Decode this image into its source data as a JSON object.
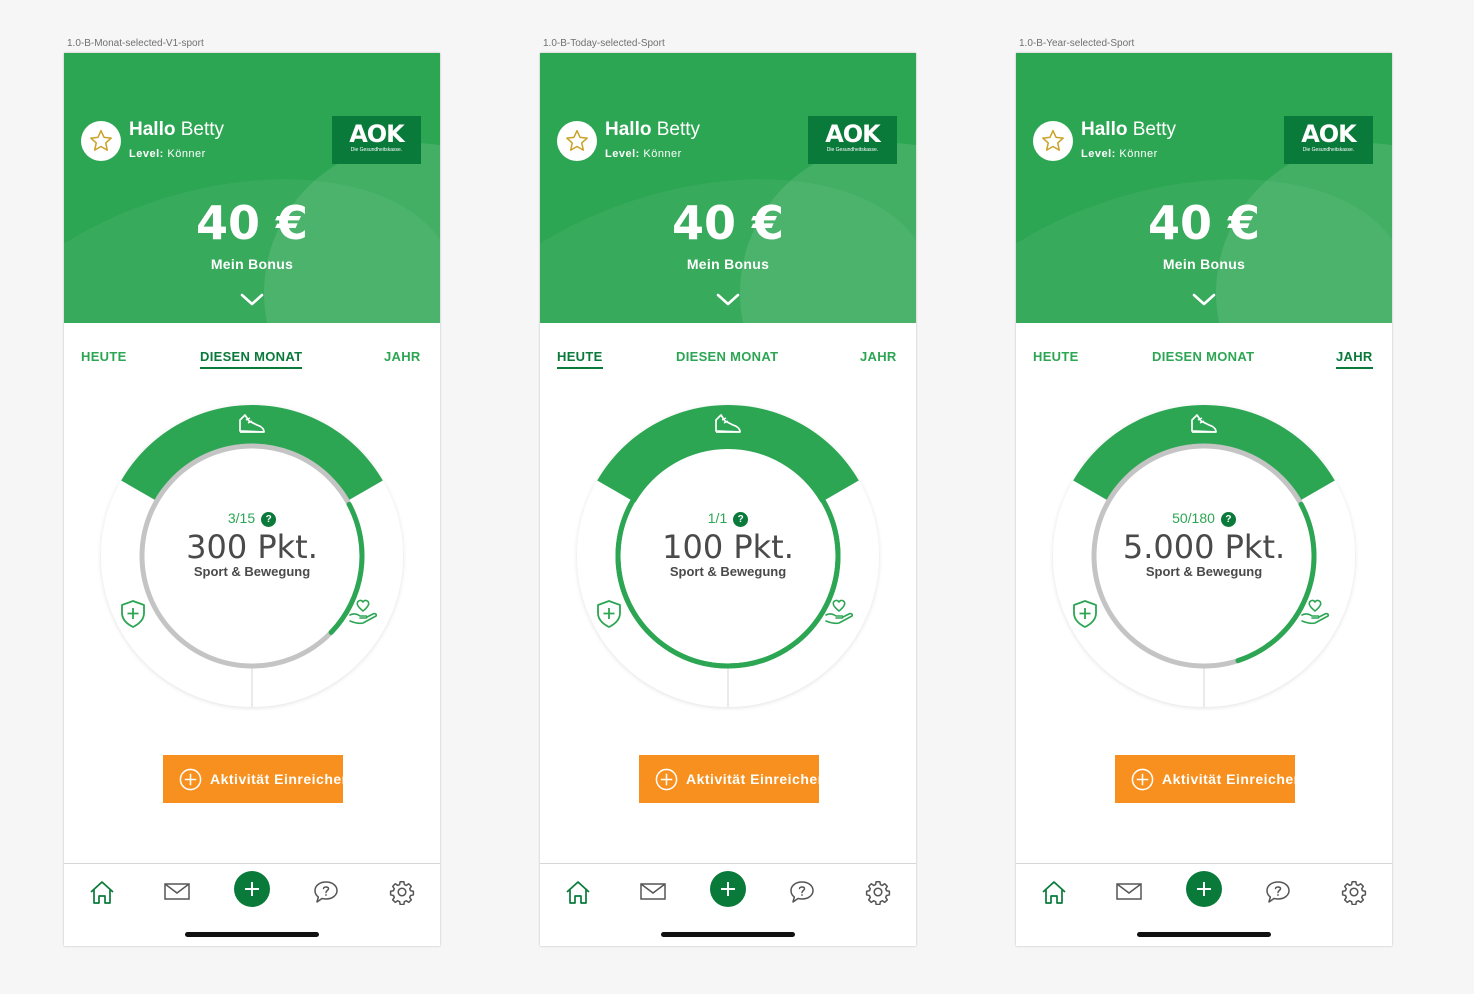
{
  "colors": {
    "green": "#2da654",
    "dark_green": "#0a7a3b",
    "orange": "#f7901e",
    "track_gray": "#c4c4c4"
  },
  "screens": [
    {
      "frame_label": "1.0-B-Monat-selected-V1-sport",
      "header": {
        "greeting_prefix": "Hallo",
        "name": "Betty",
        "level_label": "Level:",
        "level_value": "Könner",
        "logo_mark": "AOK",
        "logo_claim": "Die Gesundheitskasse.",
        "bonus_amount": "40 €",
        "bonus_label": "Mein Bonus"
      },
      "tabs": [
        {
          "label": "HEUTE",
          "active": false
        },
        {
          "label": "DIESEN MONAT",
          "active": true
        },
        {
          "label": "JAHR",
          "active": false
        }
      ],
      "ring": {
        "fraction": "3/15",
        "points": "300 Pkt.",
        "category": "Sport & Bewegung",
        "progress": 0.2
      },
      "cta_label": "Aktivität Einreichen",
      "icons": {
        "avatar": "star-icon",
        "selected_segment": "sneaker-icon",
        "left_segment": "shield-icon",
        "right_segment": "heart-hand-icon"
      }
    },
    {
      "frame_label": "1.0-B-Today-selected-Sport",
      "header": {
        "greeting_prefix": "Hallo",
        "name": "Betty",
        "level_label": "Level:",
        "level_value": "Könner",
        "logo_mark": "AOK",
        "logo_claim": "Die Gesundheitskasse.",
        "bonus_amount": "40 €",
        "bonus_label": "Mein Bonus"
      },
      "tabs": [
        {
          "label": "HEUTE",
          "active": true
        },
        {
          "label": "DIESEN MONAT",
          "active": false
        },
        {
          "label": "JAHR",
          "active": false
        }
      ],
      "ring": {
        "fraction": "1/1",
        "points": "100 Pkt.",
        "category": "Sport & Bewegung",
        "progress": 1.0
      },
      "cta_label": "Aktivität Einreichen",
      "icons": {
        "avatar": "star-icon",
        "selected_segment": "sneaker-icon",
        "left_segment": "shield-icon",
        "right_segment": "heart-hand-icon"
      }
    },
    {
      "frame_label": "1.0-B-Year-selected-Sport",
      "header": {
        "greeting_prefix": "Hallo",
        "name": "Betty",
        "level_label": "Level:",
        "level_value": "Könner",
        "logo_mark": "AOK",
        "logo_claim": "Die Gesundheitskasse.",
        "bonus_amount": "40 €",
        "bonus_label": "Mein Bonus"
      },
      "tabs": [
        {
          "label": "HEUTE",
          "active": false
        },
        {
          "label": "DIESEN MONAT",
          "active": false
        },
        {
          "label": "JAHR",
          "active": true
        }
      ],
      "ring": {
        "fraction": "50/180",
        "points": "5.000 Pkt.",
        "category": "Sport & Bewegung",
        "progress": 0.2778
      },
      "cta_label": "Aktivität Einreichen",
      "icons": {
        "avatar": "star-icon",
        "selected_segment": "sneaker-icon",
        "left_segment": "shield-icon",
        "right_segment": "heart-hand-icon"
      }
    }
  ],
  "bottom_nav": [
    "home-icon",
    "mail-icon",
    "add-icon",
    "chat-question-icon",
    "settings-gear-icon"
  ]
}
